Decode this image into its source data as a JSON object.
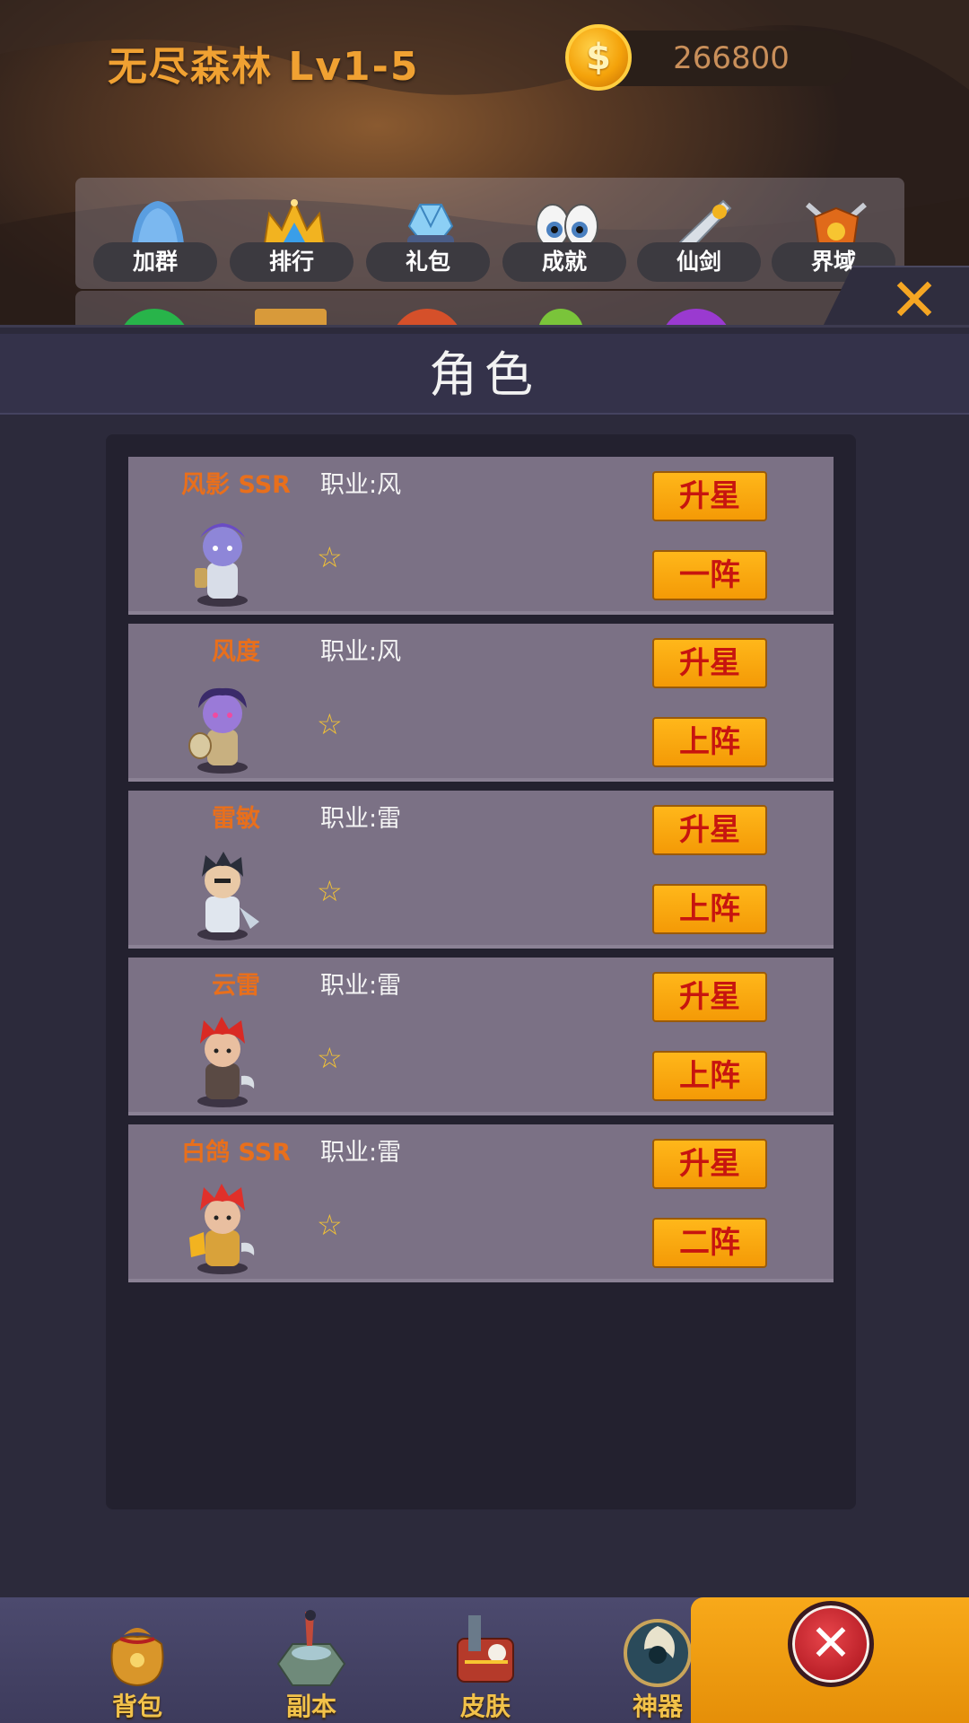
{
  "header": {
    "stage_title": "无尽森林 Lv1-5",
    "coin_symbol": "$",
    "coins": "266800"
  },
  "menu": {
    "items": [
      {
        "label": "加群",
        "icon": "group-icon"
      },
      {
        "label": "排行",
        "icon": "crown-icon"
      },
      {
        "label": "礼包",
        "icon": "gift-crystal-icon"
      },
      {
        "label": "成就",
        "icon": "eyes-icon"
      },
      {
        "label": "仙剑",
        "icon": "sword-icon"
      },
      {
        "label": "界域",
        "icon": "shield-swords-icon"
      }
    ],
    "close_symbol": "✕"
  },
  "sheet": {
    "title": "角色"
  },
  "characters": [
    {
      "name": "风影 SSR",
      "job": "职业:风",
      "star": "☆",
      "upgrade_label": "升星",
      "team_label": "一阵"
    },
    {
      "name": "风度",
      "job": "职业:风",
      "star": "☆",
      "upgrade_label": "升星",
      "team_label": "上阵"
    },
    {
      "name": "雷敏",
      "job": "职业:雷",
      "star": "☆",
      "upgrade_label": "升星",
      "team_label": "上阵"
    },
    {
      "name": "云雷",
      "job": "职业:雷",
      "star": "☆",
      "upgrade_label": "升星",
      "team_label": "上阵"
    },
    {
      "name": "白鸽 SSR",
      "job": "职业:雷",
      "star": "☆",
      "upgrade_label": "升星",
      "team_label": "二阵"
    }
  ],
  "bottom_nav": {
    "items": [
      {
        "label": "背包",
        "icon": "bag-icon"
      },
      {
        "label": "副本",
        "icon": "dungeon-icon"
      },
      {
        "label": "皮肤",
        "icon": "skin-icon"
      },
      {
        "label": "神器",
        "icon": "artifact-icon"
      }
    ],
    "close_symbol": "✕"
  },
  "colors": {
    "accent_orange": "#f5a623",
    "card_bg": "#7b7185",
    "button_text": "#c7150f",
    "name_text": "#e86f1c"
  }
}
